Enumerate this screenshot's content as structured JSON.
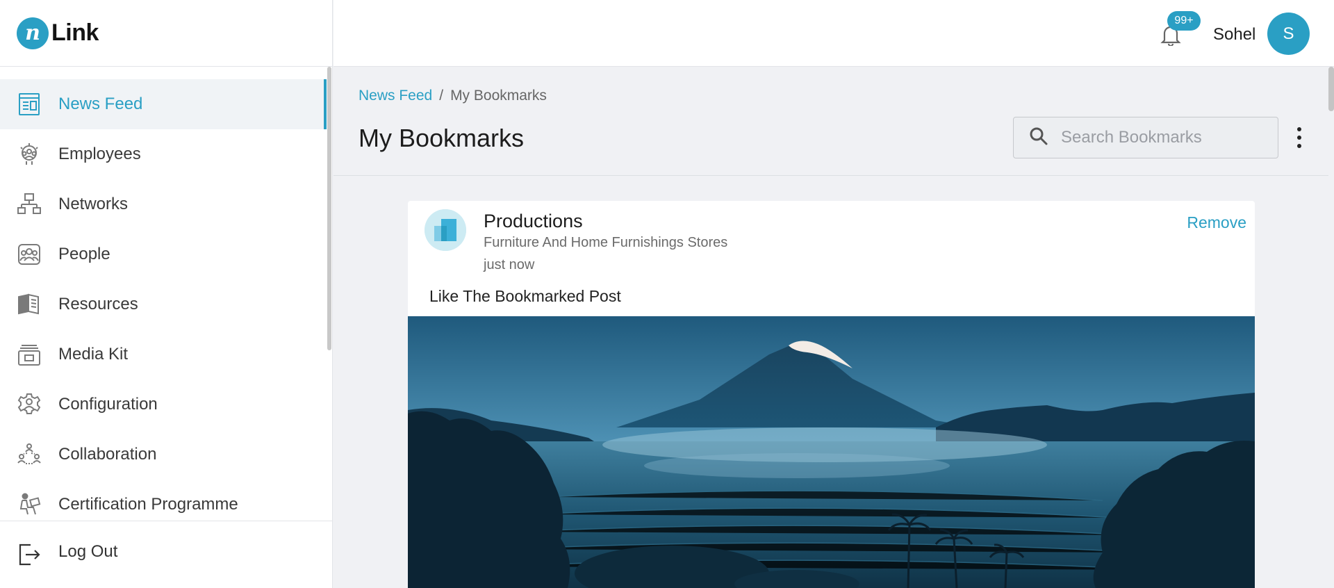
{
  "app": {
    "logo_mark": "n",
    "logo_text": "Link"
  },
  "sidebar": {
    "items": [
      {
        "label": "News Feed",
        "icon": "news-feed-icon",
        "active": true
      },
      {
        "label": "Employees",
        "icon": "employees-icon",
        "active": false
      },
      {
        "label": "Networks",
        "icon": "networks-icon",
        "active": false
      },
      {
        "label": "People",
        "icon": "people-icon",
        "active": false
      },
      {
        "label": "Resources",
        "icon": "resources-icon",
        "active": false
      },
      {
        "label": "Media Kit",
        "icon": "media-kit-icon",
        "active": false
      },
      {
        "label": "Configuration",
        "icon": "gear-icon",
        "active": false
      },
      {
        "label": "Collaboration",
        "icon": "collaboration-icon",
        "active": false
      },
      {
        "label": "Certification Programme",
        "icon": "certification-icon",
        "active": false
      }
    ],
    "logout_label": "Log Out"
  },
  "header": {
    "notification_badge": "99+",
    "username": "Sohel",
    "avatar_initial": "S"
  },
  "breadcrumb": {
    "parent": "News Feed",
    "separator": "/",
    "current": "My Bookmarks"
  },
  "page": {
    "title": "My Bookmarks",
    "search_placeholder": "Search Bookmarks",
    "search_value": ""
  },
  "bookmark": {
    "org_name": "Productions",
    "industry": "Furniture And Home Furnishings Stores",
    "time": "just now",
    "remove_label": "Remove",
    "post_text": "Like The Bookmarked Post",
    "image_subject": "volcano-landscape"
  },
  "colors": {
    "accent": "#2a9fc4",
    "background": "#f0f1f4",
    "active_nav_bg": "#f0f3f6"
  }
}
